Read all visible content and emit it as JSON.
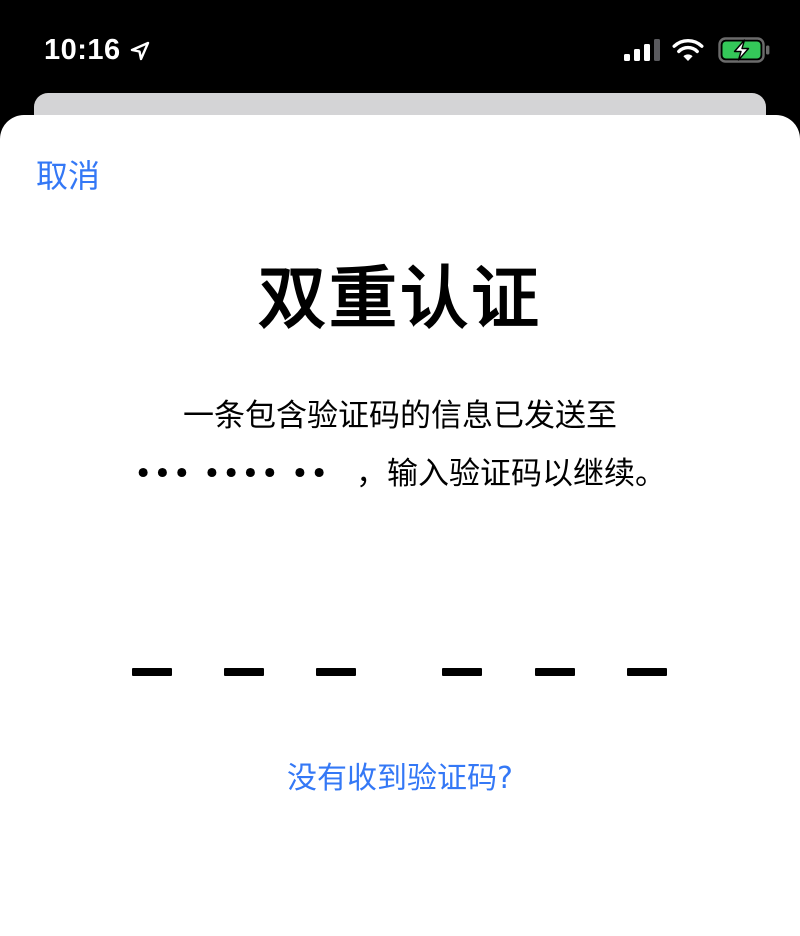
{
  "status_bar": {
    "time": "10:16",
    "icons": [
      "location-icon",
      "cellular-signal-icon",
      "wifi-icon",
      "battery-charging-icon"
    ],
    "battery_color": "#34c759"
  },
  "sheet": {
    "cancel_label": "取消",
    "title": "双重认证",
    "message_line1": "一条包含验证码的信息已发送至",
    "masked_phone": "••• •••• ••",
    "message_line2_suffix": "，输入验证码以继续。",
    "code_slots": [
      "",
      "",
      "",
      "",
      "",
      ""
    ],
    "no_code_label": "没有收到验证码?"
  },
  "colors": {
    "accent": "#3478f6",
    "text": "#000000",
    "background": "#ffffff"
  }
}
